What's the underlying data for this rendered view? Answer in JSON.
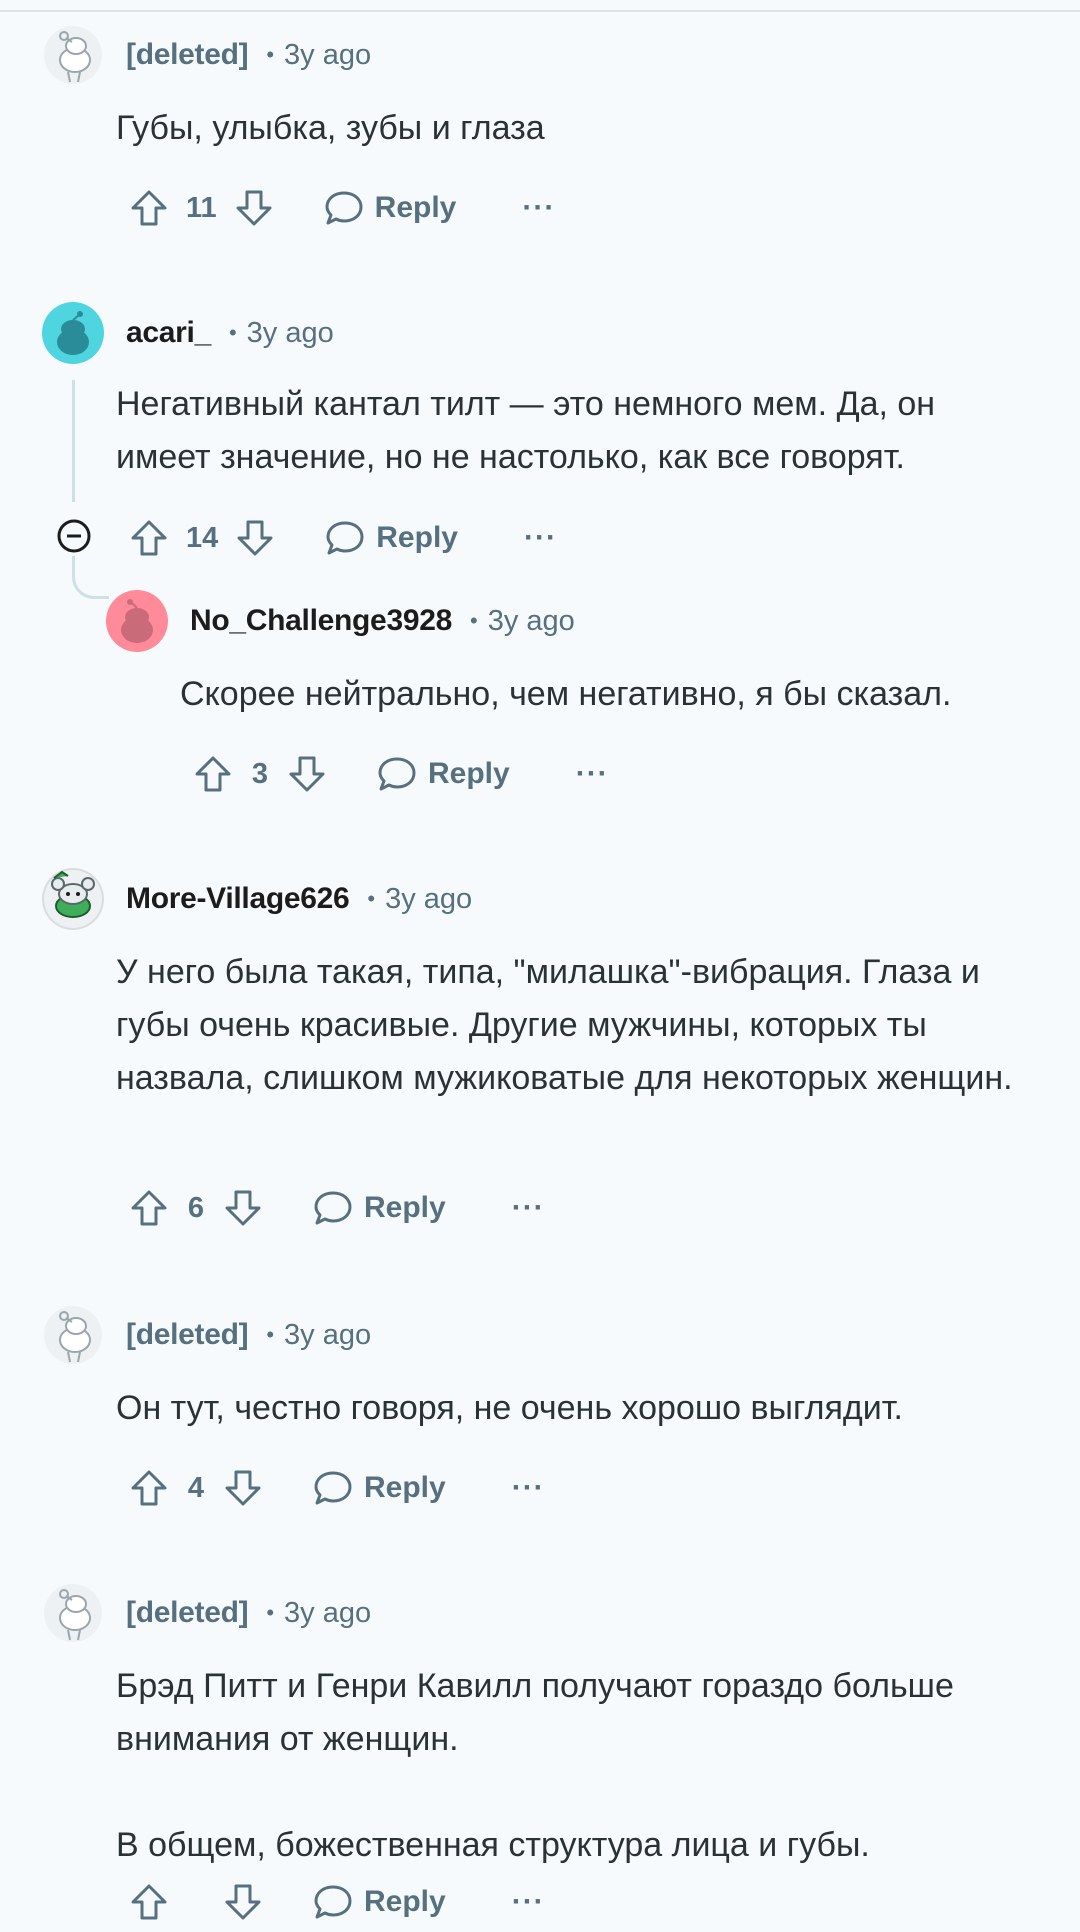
{
  "comments": [
    {
      "username": "[deleted]",
      "time": "3y ago",
      "body": [
        "Губы, улыбка, зубы и глаза"
      ],
      "votes": "11",
      "reply": "Reply",
      "more": "···"
    },
    {
      "username": "acari_",
      "time": "3y ago",
      "body": [
        "Негативный кантал тилт — это немного мем. Да, он имеет значение, но не настолько, как все говорят."
      ],
      "votes": "14",
      "reply": "Reply",
      "more": "···"
    },
    {
      "username": "No_Challenge3928",
      "time": "3y ago",
      "body": [
        "Скорее нейтрально, чем негативно, я бы сказал."
      ],
      "votes": "3",
      "reply": "Reply",
      "more": "···"
    },
    {
      "username": "More-Village626",
      "time": "3y ago",
      "body": [
        "У него была такая, типа, \"милашка\"-вибрация. Глаза и губы очень красивые. Другие мужчины, которых ты назвала, слишком мужиковатые для некоторых женщин."
      ],
      "votes": "6",
      "reply": "Reply",
      "more": "···"
    },
    {
      "username": "[deleted]",
      "time": "3y ago",
      "body": [
        "Он тут, честно говоря, не очень хорошо выглядит."
      ],
      "votes": "4",
      "reply": "Reply",
      "more": "···"
    },
    {
      "username": "[deleted]",
      "time": "3y ago",
      "body": [
        "Брэд Питт и Генри Кавилл получают гораздо больше внимания от женщин.",
        "В общем, божественная структура лица и губы."
      ],
      "votes": "",
      "reply": "Reply",
      "more": "···"
    }
  ],
  "separator": "•",
  "icons": {
    "upvote": "upvote-arrow-icon",
    "downvote": "downvote-arrow-icon",
    "reply": "speech-bubble-icon",
    "collapse": "collapse-minus-icon"
  },
  "colors": {
    "meta": "#56707f",
    "thread": "#cfdfe6",
    "background": "#f7fafc"
  }
}
